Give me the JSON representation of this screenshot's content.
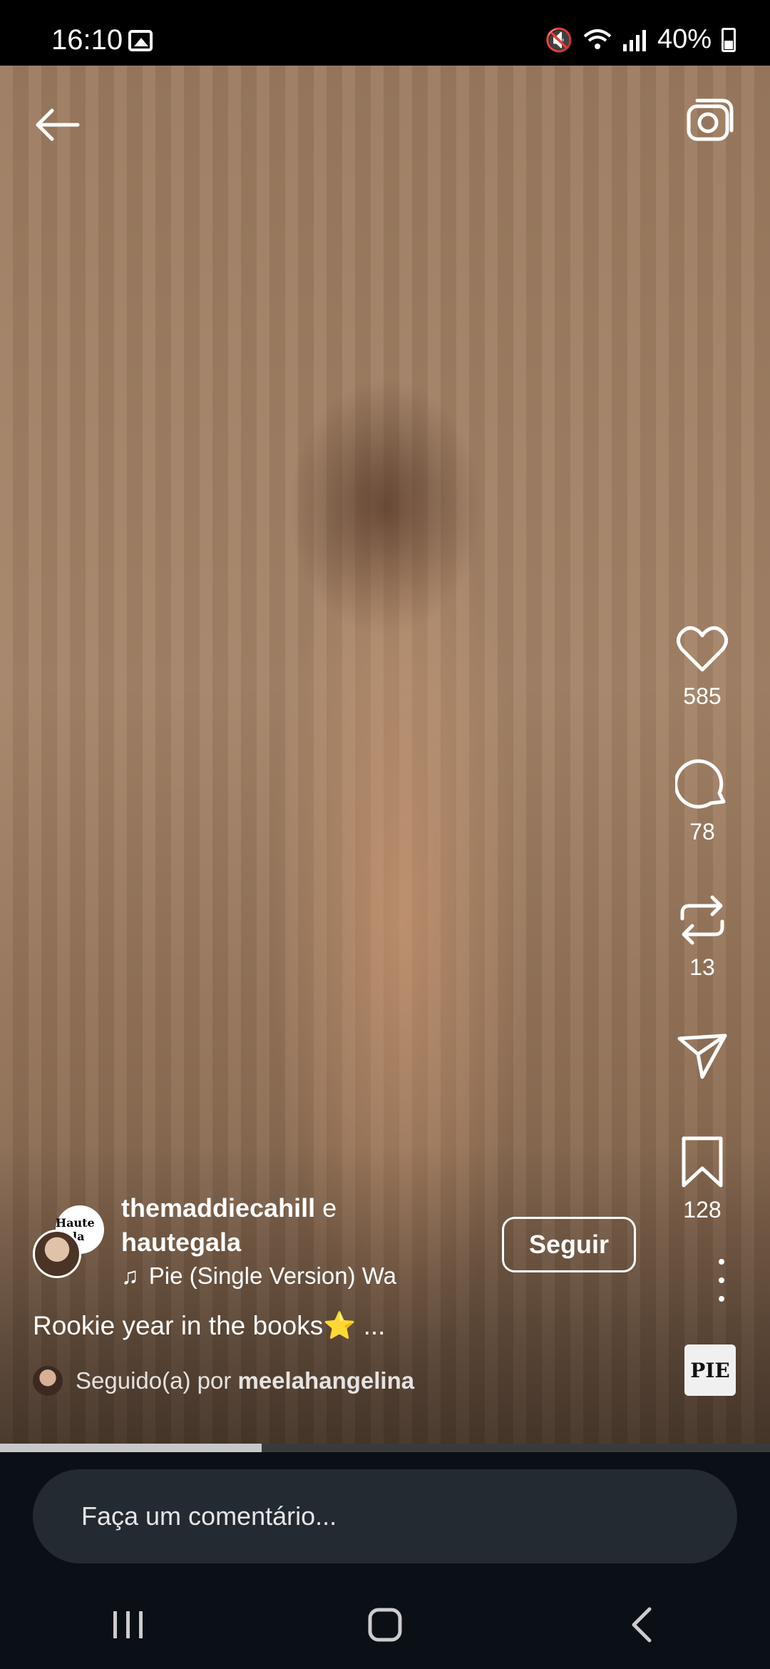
{
  "status_bar": {
    "time": "16:10",
    "battery": "40%",
    "icons": [
      "gallery-icon",
      "mute-icon",
      "wifi-icon",
      "signal-icon",
      "battery-icon"
    ]
  },
  "post": {
    "author_primary": "themaddiecahill",
    "connector": "e",
    "author_secondary": "hautegala",
    "brand_avatar_text": "Haute Gala",
    "music": "Pie (Single Version)   Wa",
    "follow_label": "Seguir",
    "caption": "Rookie year in the books⭐ ...",
    "followed_prefix": "Seguido(a) por",
    "followed_user": "meelahangelina"
  },
  "actions": {
    "likes": "585",
    "comments": "78",
    "reposts": "13",
    "saves": "128",
    "album_art_text": "PIE"
  },
  "playback": {
    "progress": 0.34
  },
  "comment_box": {
    "placeholder": "Faça um comentário..."
  },
  "colors": {
    "progress_fill": "#c8c8c8",
    "progress_track": "#3a3a3a",
    "bottom_bg": "#0b0f16",
    "input_bg": "#242a32"
  }
}
